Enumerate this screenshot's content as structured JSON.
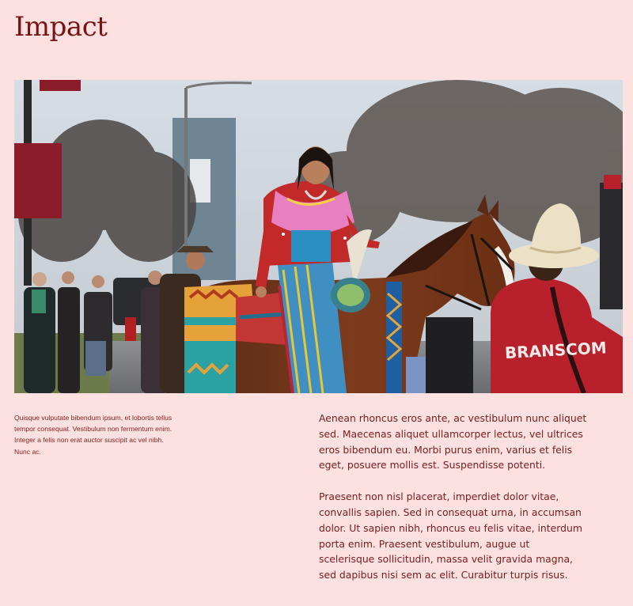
{
  "page": {
    "title": "Impact"
  },
  "hero": {
    "jacket_text": "BRANSCOM"
  },
  "caption": {
    "text": "Quisque vulputate bibendum ipsum, et lobortis tellus tempor consequat. Vestibulum non fermentum enim. Integer a felis non erat auctor suscipit ac vel nibh. Nunc ac."
  },
  "body": {
    "paragraphs": [
      "Aenean rhoncus eros ante, ac vestibulum nunc aliquet sed. Maecenas aliquet ullamcorper lectus, vel ultrices eros bibendum eu. Morbi purus enim, varius et felis eget, posuere mollis est. Suspendisse potenti.",
      "Praesent non nisl placerat, imperdiet dolor vitae, convallis sapien. Sed in consequat urna, in accumsan dolor. Ut sapien nibh, rhoncus eu felis vitae, interdum porta enim. Praesent vestibulum, augue ut scelerisque sollicitudin, massa velit gravida magna, sed dapibus nisi sem ac elit. Curabitur turpis risus."
    ]
  },
  "colors": {
    "background": "#fde0e0",
    "title": "#7a1414",
    "text": "#7a1d1d"
  }
}
